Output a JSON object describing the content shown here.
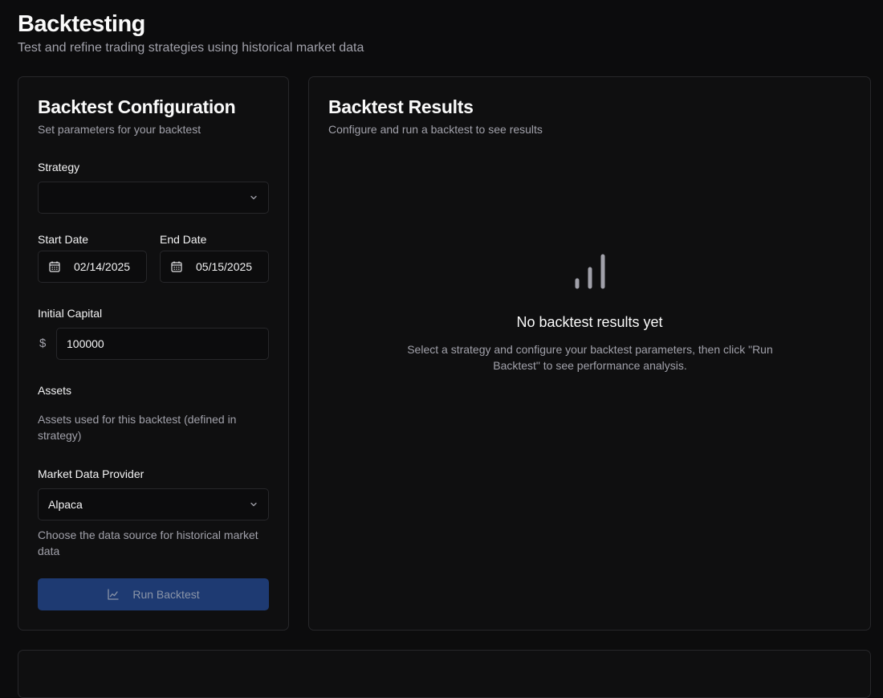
{
  "header": {
    "title": "Backtesting",
    "subtitle": "Test and refine trading strategies using historical market data"
  },
  "config": {
    "title": "Backtest Configuration",
    "description": "Set parameters for your backtest",
    "strategy": {
      "label": "Strategy",
      "value": ""
    },
    "start_date": {
      "label": "Start Date",
      "value": "02/14/2025"
    },
    "end_date": {
      "label": "End Date",
      "value": "05/15/2025"
    },
    "initial_capital": {
      "label": "Initial Capital",
      "currency_symbol": "$",
      "value": "100000"
    },
    "assets": {
      "label": "Assets",
      "helper": "Assets used for this backtest (defined in strategy)"
    },
    "provider": {
      "label": "Market Data Provider",
      "value": "Alpaca",
      "helper": "Choose the data source for historical market data"
    },
    "run_button": {
      "label": "Run Backtest",
      "icon": "line-chart-icon"
    }
  },
  "results": {
    "title": "Backtest Results",
    "description": "Configure and run a backtest to see results",
    "empty_title": "No backtest results yet",
    "empty_description": "Select a strategy and configure your backtest parameters, then click \"Run Backtest\" to see performance analysis.",
    "empty_icon": "bar-signal-icon"
  },
  "colors": {
    "background": "#0c0c0d",
    "card_border": "#27272a",
    "muted_text": "#a1a1aa",
    "primary_button": "#1e3a72"
  }
}
